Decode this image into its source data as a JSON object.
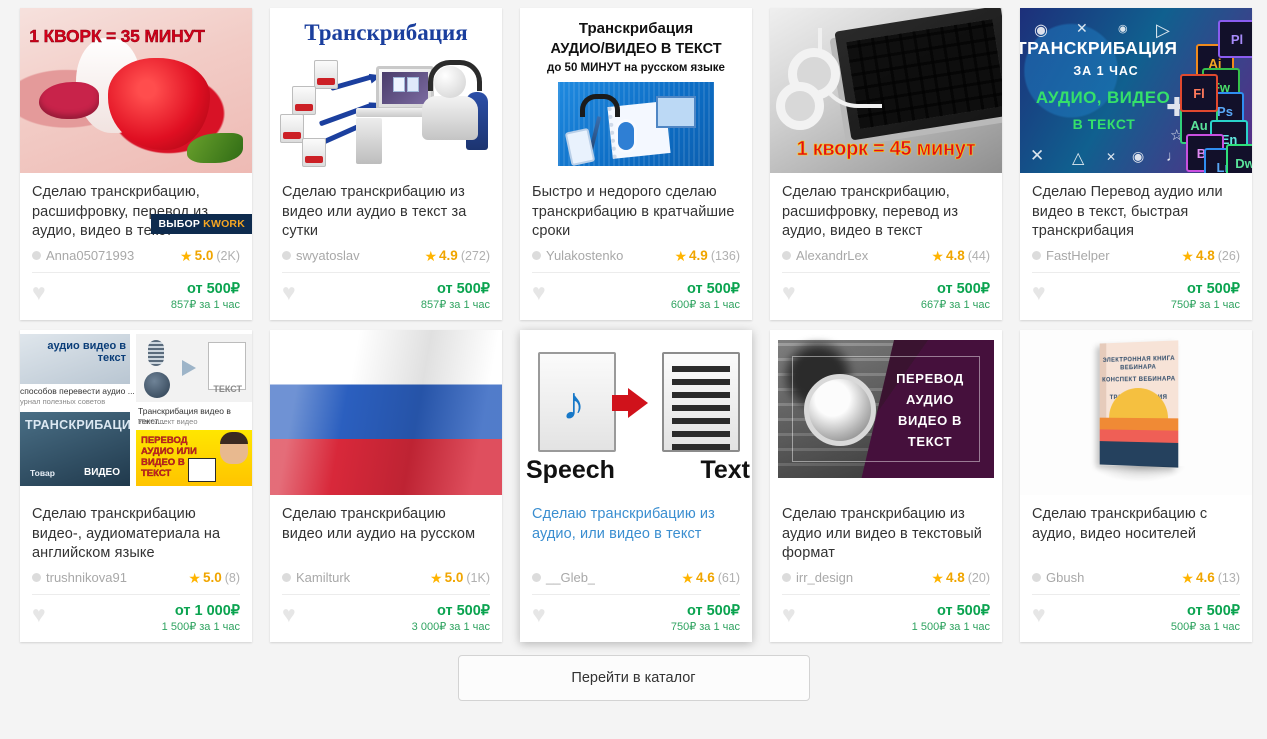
{
  "page": {
    "background": "#f4f4f4",
    "accent_green": "#0aa34f",
    "accent_star": "#ffb400",
    "link_blue": "#3a8ed0",
    "badge_navy": "#0e2b4e"
  },
  "catalog_button": {
    "label": "Перейти в каталог"
  },
  "labels": {
    "per_hour_suffix": "за 1 час",
    "price_prefix": "от",
    "currency": "₽",
    "favorite_icon": "heart-icon",
    "star_icon": "star-icon"
  },
  "cards": [
    {
      "id": "card-1",
      "title": "Сделаю транскрибацию, расшифровку, перевод из аудио, видео в текст",
      "seller": "Anna05071993",
      "rating": "5.0",
      "reviews": "(2K)",
      "price": "от 500₽",
      "price_sub": "857₽ за 1 час",
      "badge": {
        "prefix": "ВЫБОР",
        "brand": "KWORK"
      },
      "title_style": "dark",
      "thumb": {
        "name": "strawberry-lips-thumb",
        "caption": "1 КВОРК = 35 МИНУТ"
      }
    },
    {
      "id": "card-2",
      "title": "Сделаю транскрибацию из видео или аудио в текст за сутки",
      "seller": "swyatoslav",
      "rating": "4.9",
      "reviews": "(272)",
      "price": "от 500₽",
      "price_sub": "857₽ за 1 час",
      "badge": null,
      "title_style": "dark",
      "thumb": {
        "name": "transcription-pc-thumb",
        "caption": "Транскрибация"
      }
    },
    {
      "id": "card-3",
      "title": "Быстро и недорого сделаю транскрибацию в кратчайшие сроки",
      "seller": "Yulakostenko",
      "rating": "4.9",
      "reviews": "(136)",
      "price": "от 500₽",
      "price_sub": "600₽ за 1 час",
      "badge": null,
      "title_style": "dark",
      "thumb": {
        "name": "audio-video-to-text-thumb",
        "line1": "Транскрибация",
        "line2": "АУДИО/ВИДЕО В ТЕКСТ",
        "line3": "до 50 МИНУТ на русском языке"
      }
    },
    {
      "id": "card-4",
      "title": "Сделаю транскрибацию, расшифровку, перевод из аудио, видео в текст",
      "seller": "AlexandrLex",
      "rating": "4.8",
      "reviews": "(44)",
      "price": "от 500₽",
      "price_sub": "667₽ за 1 час",
      "badge": null,
      "title_style": "dark",
      "thumb": {
        "name": "laptop-headphones-thumb",
        "caption": "1 кворк = 45 минут"
      }
    },
    {
      "id": "card-5",
      "title": "Сделаю Перевод аудио или видео в текст, быстрая транскрибация",
      "seller": "FastHelper",
      "rating": "4.8",
      "reviews": "(26)",
      "price": "от 500₽",
      "price_sub": "750₽ за 1 час",
      "badge": null,
      "title_style": "dark",
      "thumb": {
        "name": "adobe-tiles-thumb",
        "line1": "ТРАНСКРИБАЦИЯ",
        "line2": "ЗА 1 ЧАС",
        "line3": "АУДИО, ВИДЕО",
        "line4": "В ТЕКСТ",
        "tiles": [
          "Ai",
          "Fw",
          "Ps",
          "Au",
          "En",
          "Fl",
          "Bs",
          "Pl",
          "Lr",
          "Dw"
        ]
      }
    },
    {
      "id": "card-6",
      "title": "Сделаю транскрибацию видео-, аудиоматериала на английском языке",
      "seller": "trushnikova91",
      "rating": "5.0",
      "reviews": "(8)",
      "price": "от 1 000₽",
      "price_sub": "1 500₽ за 1 час",
      "badge": null,
      "title_style": "dark",
      "thumb": {
        "name": "search-results-collage-thumb",
        "tile1_label": "аудио видео в текст",
        "tile1_caption": "способов перевести аудио ...",
        "tile1_subcaption": "урнал полезных советов",
        "tile2_caption": "Транскрибация видео в текст...",
        "tile2_subcaption": "Интеллект видео",
        "tile3_label": "ТРАНСКРИБАЦИЯ",
        "tile3_sub_left": "Товар",
        "tile3_sub_right": "ВИДЕО",
        "tile4_label": "ПЕРЕВОД АУДИО ИЛИ ВИДЕО В ТЕКСТ",
        "tile2_inner": "ТЕКСТ"
      }
    },
    {
      "id": "card-7",
      "title": "Сделаю транскрибацию видео или аудио на русском",
      "seller": "Kamilturk",
      "rating": "5.0",
      "reviews": "(1K)",
      "price": "от 500₽",
      "price_sub": "3 000₽ за 1 час",
      "badge": null,
      "title_style": "dark",
      "thumb": {
        "name": "russian-flag-thumb"
      }
    },
    {
      "id": "card-8",
      "title": "Сделаю транскрибацию из аудио, или видео в текст",
      "seller": "__Gleb_",
      "rating": "4.6",
      "reviews": "(61)",
      "price": "от 500₽",
      "price_sub": "750₽ за 1 час",
      "badge": null,
      "title_style": "blue",
      "hovered": true,
      "thumb": {
        "name": "speech-to-text-thumb",
        "label_left": "Speech",
        "label_right": "Text"
      }
    },
    {
      "id": "card-9",
      "title": "Сделаю транскрибацию из аудио или видео в текстовый формат",
      "seller": "irr_design",
      "rating": "4.8",
      "reviews": "(20)",
      "price": "от 500₽",
      "price_sub": "1 500₽ за 1 час",
      "badge": null,
      "title_style": "dark",
      "thumb": {
        "name": "headphones-keyboard-thumb",
        "caption": "ПЕРЕВОД АУДИО ВИДЕО В ТЕКСТ"
      }
    },
    {
      "id": "card-10",
      "title": "Сделаю транскрибацию с аудио, видео носителей",
      "seller": "Gbush",
      "rating": "4.6",
      "reviews": "(13)",
      "price": "от 500₽",
      "price_sub": "500₽ за 1 час",
      "badge": null,
      "title_style": "dark",
      "thumb": {
        "name": "ebook-cover-thumb",
        "line1": "ЭЛЕКТРОННАЯ КНИГА ВЕБИНАРА",
        "line2": "КОНСПЕКТ ВЕБИНАРА",
        "line3": "ТРАНСКРИБАЦИЯ"
      }
    }
  ]
}
